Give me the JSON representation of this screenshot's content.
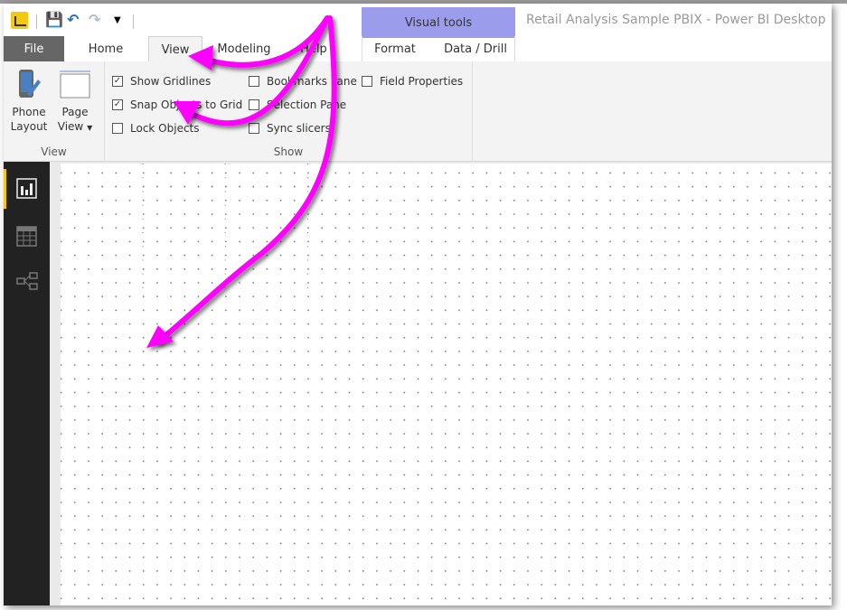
{
  "window": {
    "title": "Retail Analysis Sample PBIX - Power BI Desktop"
  },
  "quick_access": {
    "icons": [
      "power-bi-logo",
      "save-icon",
      "undo-icon",
      "redo-icon",
      "customize-dropdown-icon"
    ]
  },
  "context_tab_group": {
    "label": "Visual tools",
    "tabs": [
      "Format",
      "Data / Drill"
    ]
  },
  "tabs": [
    "File",
    "Home",
    "View",
    "Modeling",
    "Help"
  ],
  "active_tab": "View",
  "ribbon": {
    "view_group": {
      "label": "View",
      "phone_layout": "Phone\nLayout",
      "phone_layout_l1": "Phone",
      "phone_layout_l2": "Layout",
      "page_view_l1": "Page",
      "page_view_l2": "View"
    },
    "show_group": {
      "label": "Show",
      "checkboxes": [
        {
          "label": "Show Gridlines",
          "checked": true
        },
        {
          "label": "Snap Objects to Grid",
          "checked": true
        },
        {
          "label": "Lock Objects",
          "checked": false
        },
        {
          "label": "Bookmarks Pane",
          "checked": false
        },
        {
          "label": "Selection Pane",
          "checked": false
        },
        {
          "label": "Sync slicers",
          "checked": false
        },
        {
          "label": "Field Properties",
          "checked": false
        }
      ]
    }
  },
  "sidebar": {
    "items": [
      "report-view",
      "data-view",
      "relationships-view"
    ],
    "active": "report-view"
  },
  "annotation_color": "#ff00ff"
}
